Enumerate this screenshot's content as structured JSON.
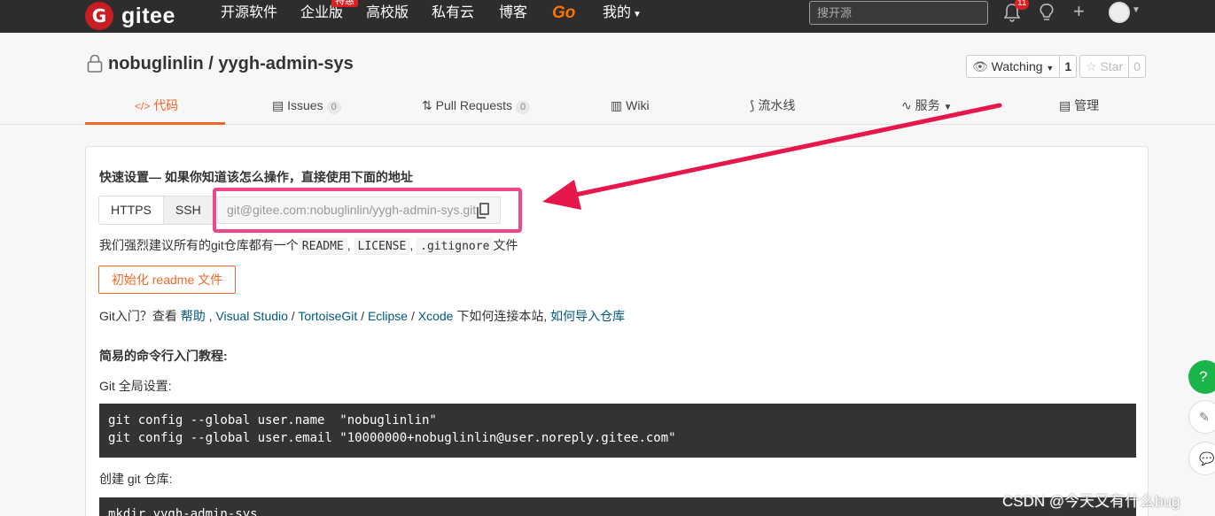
{
  "topbar": {
    "logo_mark": "G",
    "logo_text": "gitee",
    "nav": [
      "开源软件",
      "企业版",
      "高校版",
      "私有云",
      "博客",
      "Go",
      "我的"
    ],
    "enterprise_badge": "特惠",
    "search_placeholder": "搜开源",
    "notification_count": "11"
  },
  "repo": {
    "owner": "nobuglinlin",
    "separator": " / ",
    "name": "yygh-admin-sys",
    "watching_label": "Watching",
    "watching_count": "1",
    "star_label": "Star",
    "star_count": "0"
  },
  "tabs": [
    {
      "label": "代码",
      "icon": "code-icon"
    },
    {
      "label": "Issues",
      "count": "0",
      "icon": "issues-icon"
    },
    {
      "label": "Pull Requests",
      "count": "0",
      "icon": "pull-request-icon"
    },
    {
      "label": "Wiki",
      "icon": "wiki-icon"
    },
    {
      "label": "流水线",
      "icon": "pipeline-icon"
    },
    {
      "label": "服务",
      "icon": "service-icon"
    },
    {
      "label": "管理",
      "icon": "manage-icon"
    }
  ],
  "quick_setup": {
    "title": "快速设置— 如果你知道该怎么操作，直接使用下面的地址",
    "protocols": [
      "HTTPS",
      "SSH"
    ],
    "url": "git@gitee.com:nobuglinlin/yygh-admin-sys.git",
    "recommend_prefix": "我们强烈建议所有的git仓库都有一个",
    "recommend_files": [
      "README",
      "LICENSE",
      ".gitignore"
    ],
    "recommend_suffix": "文件",
    "init_button": "初始化 readme 文件"
  },
  "git_entry": {
    "prefix": "Git入门？查看",
    "help": "帮助",
    "vs": "Visual Studio",
    "tortoise": "TortoiseGit",
    "eclipse": "Eclipse",
    "xcode": "Xcode",
    "middle": "下如何连接本站,",
    "import": "如何导入仓库"
  },
  "tutorial": {
    "title": "简易的命令行入门教程:",
    "global_label": "Git 全局设置:",
    "global_cmd1": "git config --global user.name  \"nobuglinlin\"",
    "global_cmd2": "git config --global user.email \"10000000+nobuglinlin@user.noreply.gitee.com\"",
    "create_label": "创建 git 仓库:",
    "create_cmd1": "mkdir yygh-admin-sys"
  },
  "floating": [
    "?",
    "✎",
    "💬"
  ],
  "watermark": "CSDN @今天又有什么bug",
  "colors": {
    "accent": "#f4662a",
    "topbar": "#2d2d2d",
    "highlight": "#f0468c",
    "arrow": "#e8174b",
    "help": "#19b44a"
  }
}
